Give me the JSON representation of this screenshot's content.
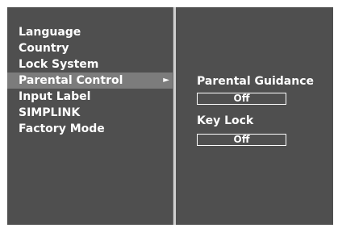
{
  "menu": {
    "items": [
      {
        "label": "Language"
      },
      {
        "label": "Country"
      },
      {
        "label": "Lock System"
      },
      {
        "label": "Parental Control",
        "selected": true
      },
      {
        "label": "Input Label"
      },
      {
        "label": "SIMPLINK"
      },
      {
        "label": "Factory Mode"
      }
    ],
    "selected_arrow": "►"
  },
  "submenu": {
    "parental_guidance": {
      "label": "Parental Guidance",
      "value": "Off"
    },
    "key_lock": {
      "label": "Key Lock",
      "value": "Off"
    }
  },
  "colors": {
    "panel_background": "#4f4f4f",
    "selected_row": "#7c7c7c",
    "text": "#ffffff",
    "divider": "#cfcfcf"
  }
}
